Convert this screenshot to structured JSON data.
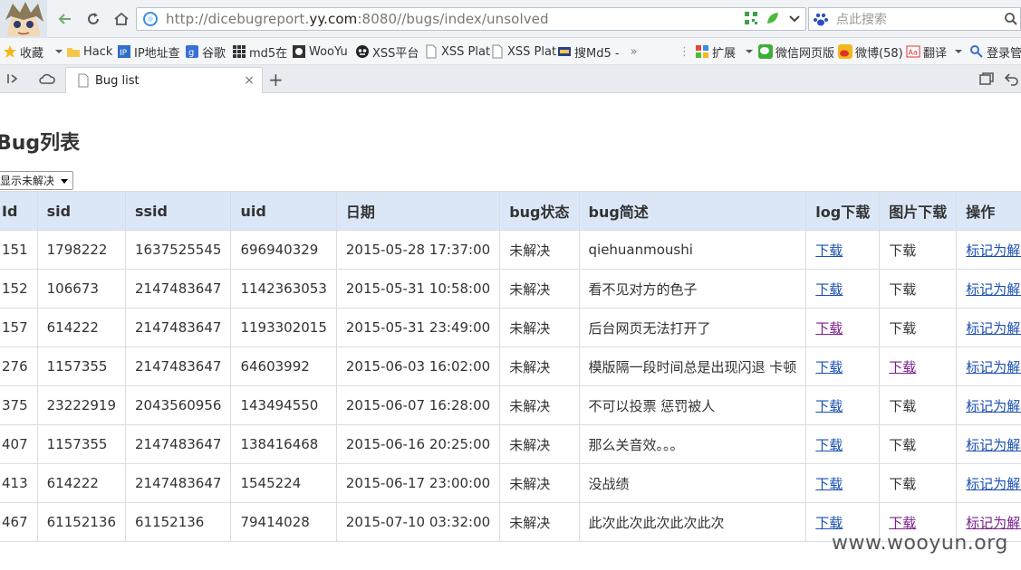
{
  "browser": {
    "url_prefix": "http://dicebugreport.",
    "url_domain": "yy.com",
    "url_suffix": ":8080//bugs/index/unsolved",
    "search_placeholder": "点此搜索"
  },
  "bookmarks": [
    {
      "label": "收藏",
      "icon": "star-icon"
    },
    {
      "label": "Hack",
      "icon": "folder-icon"
    },
    {
      "label": "IP地址查",
      "icon": "ip-icon"
    },
    {
      "label": "谷歌",
      "icon": "google-icon"
    },
    {
      "label": "md5在",
      "icon": "grid-icon"
    },
    {
      "label": "WooYu",
      "icon": "wooyun-icon"
    },
    {
      "label": "XSS平台",
      "icon": "xss-icon"
    },
    {
      "label": "XSS Plat",
      "icon": "page-icon"
    },
    {
      "label": "XSS Plat",
      "icon": "page-icon"
    },
    {
      "label": "搜Md5 -",
      "icon": "md5-icon"
    },
    {
      "label": "扩展",
      "icon": "extension-icon"
    },
    {
      "label": "微信网页版",
      "icon": "wechat-icon"
    },
    {
      "label": "微博(58)",
      "icon": "weibo-icon"
    },
    {
      "label": "翻译",
      "icon": "translate-icon"
    },
    {
      "label": "登录管",
      "icon": "login-icon"
    }
  ],
  "tab": {
    "title": "Bug list",
    "close": "×",
    "new": "+"
  },
  "page": {
    "title": "Bug列表",
    "filter_selected": "显示未解决"
  },
  "table": {
    "headers": [
      "Id",
      "sid",
      "ssid",
      "uid",
      "日期",
      "bug状态",
      "bug简述",
      "log下载",
      "图片下载",
      "操作"
    ],
    "rows": [
      {
        "id": "151",
        "sid": "1798222",
        "ssid": "1637525545",
        "uid": "696940329",
        "date": "2015-05-28 17:37:00",
        "status": "未解决",
        "desc": "qiehuanmoushi",
        "log": "下载",
        "img": "下载",
        "img_link": false,
        "action": "标记为解决"
      },
      {
        "id": "152",
        "sid": "106673",
        "ssid": "2147483647",
        "uid": "1142363053",
        "date": "2015-05-31 10:58:00",
        "status": "未解决",
        "desc": "看不见对方的色子",
        "log": "下载",
        "img": "下载",
        "img_link": false,
        "action": "标记为解决"
      },
      {
        "id": "157",
        "sid": "614222",
        "ssid": "2147483647",
        "uid": "1193302015",
        "date": "2015-05-31 23:49:00",
        "status": "未解决",
        "desc": "后台网页无法打开了",
        "log": "下载",
        "img": "下载",
        "img_link": false,
        "action": "标记为解决"
      },
      {
        "id": "276",
        "sid": "1157355",
        "ssid": "2147483647",
        "uid": "64603992",
        "date": "2015-06-03 16:02:00",
        "status": "未解决",
        "desc": "模版隔一段时间总是出现闪退 卡顿",
        "log": "下载",
        "img": "下载",
        "img_link": true,
        "action": "标记为解决"
      },
      {
        "id": "375",
        "sid": "23222919",
        "ssid": "2043560956",
        "uid": "143494550",
        "date": "2015-06-07 16:28:00",
        "status": "未解决",
        "desc": "不可以投票 惩罚被人",
        "log": "下载",
        "img": "下载",
        "img_link": false,
        "action": "标记为解决"
      },
      {
        "id": "407",
        "sid": "1157355",
        "ssid": "2147483647",
        "uid": "138416468",
        "date": "2015-06-16 20:25:00",
        "status": "未解决",
        "desc": "那么关音效。。。",
        "log": "下载",
        "img": "下载",
        "img_link": false,
        "action": "标记为解决"
      },
      {
        "id": "413",
        "sid": "614222",
        "ssid": "2147483647",
        "uid": "1545224",
        "date": "2015-06-17 23:00:00",
        "status": "未解决",
        "desc": "没战绩",
        "log": "下载",
        "img": "下载",
        "img_link": false,
        "action": "标记为解决"
      },
      {
        "id": "467",
        "sid": "61152136",
        "ssid": "61152136",
        "uid": "79414028",
        "date": "2015-07-10 03:32:00",
        "status": "未解决",
        "desc": "此次此次此次此次此次",
        "log": "下载",
        "img": "下载",
        "img_link": true,
        "action": "标记为解决"
      }
    ]
  },
  "watermark": "www.wooyun.org",
  "colors": {
    "header_bg": "#dbe7f7",
    "link": "#1a4fb3",
    "visited": "#7a1f8e"
  }
}
